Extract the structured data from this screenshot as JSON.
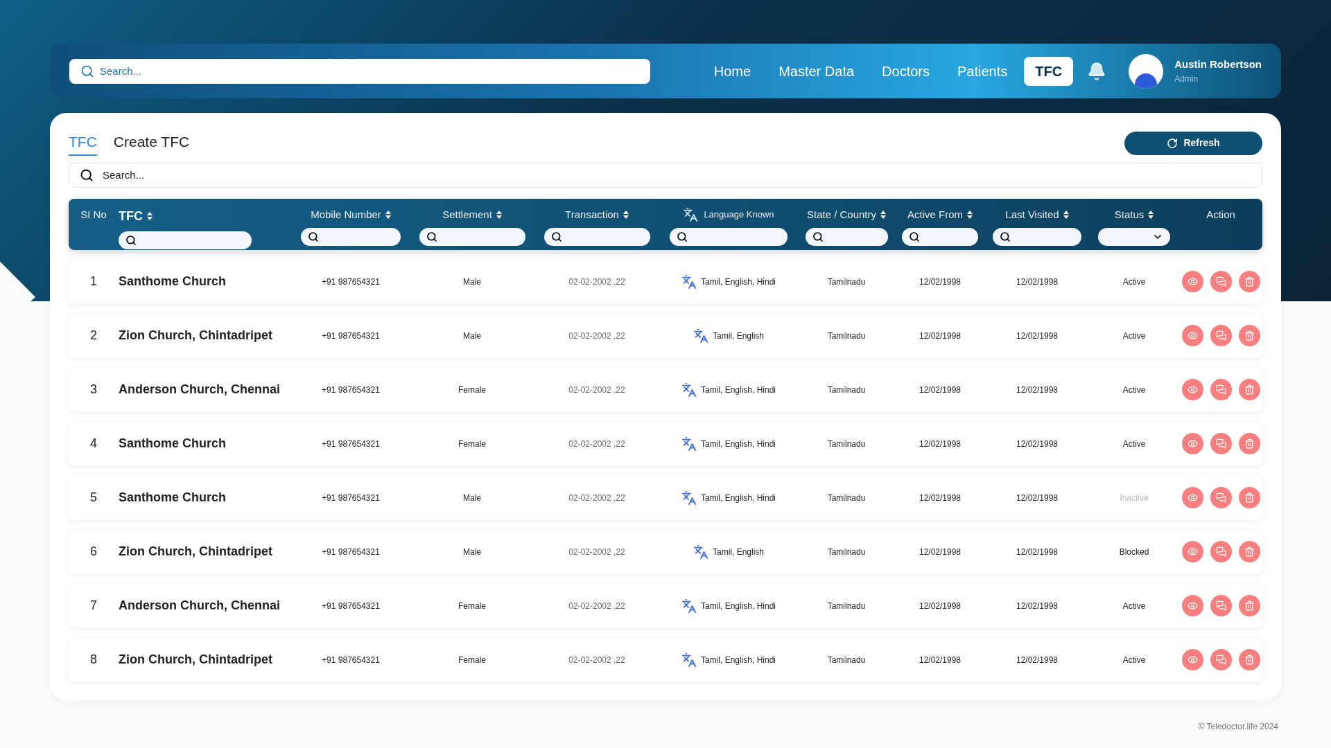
{
  "navbar": {
    "search": {
      "placeholder": "Search..."
    },
    "links": [
      {
        "label": "Home",
        "selected": false
      },
      {
        "label": "Master Data",
        "selected": false
      },
      {
        "label": "Doctors",
        "selected": false
      },
      {
        "label": "Patients",
        "selected": false
      },
      {
        "label": "TFC",
        "selected": true
      }
    ],
    "user": {
      "name": "Austin Robertson",
      "role": "Admin"
    }
  },
  "tabs": [
    {
      "label": "TFC",
      "selected": true
    },
    {
      "label": "Create TFC",
      "selected": false
    }
  ],
  "refresh_button": "Refresh",
  "search": {
    "placeholder": "Search..."
  },
  "table": {
    "columns": [
      {
        "label": "SI No",
        "sortable": false,
        "kind": "plain"
      },
      {
        "label": "TFC",
        "sortable": true,
        "kind": "search"
      },
      {
        "label": "Mobile Number",
        "sortable": true,
        "kind": "search"
      },
      {
        "label": "Settlement",
        "sortable": true,
        "kind": "search"
      },
      {
        "label": "Transaction",
        "sortable": true,
        "kind": "search"
      },
      {
        "label": "Language Known",
        "sortable": false,
        "kind": "search"
      },
      {
        "label": "State / Country",
        "sortable": true,
        "kind": "search"
      },
      {
        "label": "Active From",
        "sortable": true,
        "kind": "search"
      },
      {
        "label": "Last Visited",
        "sortable": true,
        "kind": "search"
      },
      {
        "label": "Status",
        "sortable": true,
        "kind": "select"
      },
      {
        "label": "Action",
        "sortable": false,
        "kind": "plain"
      }
    ],
    "rows": [
      {
        "no": "1",
        "tfc": "Santhome Church",
        "mobile": "+91 987654321",
        "settlement": "Male",
        "transaction": "02-02-2002 ,22",
        "languages": "Tamil, English, Hindi",
        "state": "Tamilnadu",
        "active_from": "12/02/1998",
        "last_visited": "12/02/1998",
        "status": "Active",
        "status_disabled": false
      },
      {
        "no": "2",
        "tfc": "Zion Church, Chintadripet",
        "mobile": "+91 987654321",
        "settlement": "Male",
        "transaction": "02-02-2002 ,22",
        "languages": "Tamil, English",
        "state": "Tamilnadu",
        "active_from": "12/02/1998",
        "last_visited": "12/02/1998",
        "status": "Active",
        "status_disabled": false
      },
      {
        "no": "3",
        "tfc": "Anderson Church, Chennai",
        "mobile": "+91 987654321",
        "settlement": "Female",
        "transaction": "02-02-2002 ,22",
        "languages": "Tamil, English, Hindi",
        "state": "Tamilnadu",
        "active_from": "12/02/1998",
        "last_visited": "12/02/1998",
        "status": "Active",
        "status_disabled": false
      },
      {
        "no": "4",
        "tfc": "Santhome Church",
        "mobile": "+91 987654321",
        "settlement": "Female",
        "transaction": "02-02-2002 ,22",
        "languages": "Tamil, English, Hindi",
        "state": "Tamilnadu",
        "active_from": "12/02/1998",
        "last_visited": "12/02/1998",
        "status": "Active",
        "status_disabled": false
      },
      {
        "no": "5",
        "tfc": "Santhome Church",
        "mobile": "+91 987654321",
        "settlement": "Male",
        "transaction": "02-02-2002 ,22",
        "languages": "Tamil, English, Hindi",
        "state": "Tamilnadu",
        "active_from": "12/02/1998",
        "last_visited": "12/02/1998",
        "status": "Inactive",
        "status_disabled": true
      },
      {
        "no": "6",
        "tfc": "Zion Church, Chintadripet",
        "mobile": "+91 987654321",
        "settlement": "Male",
        "transaction": "02-02-2002 ,22",
        "languages": "Tamil, English",
        "state": "Tamilnadu",
        "active_from": "12/02/1998",
        "last_visited": "12/02/1998",
        "status": "Blocked",
        "status_disabled": false
      },
      {
        "no": "7",
        "tfc": "Anderson Church, Chennai",
        "mobile": "+91 987654321",
        "settlement": "Female",
        "transaction": "02-02-2002 ,22",
        "languages": "Tamil, English, Hindi",
        "state": "Tamilnadu",
        "active_from": "12/02/1998",
        "last_visited": "12/02/1998",
        "status": "Active",
        "status_disabled": false
      },
      {
        "no": "8",
        "tfc": "Zion Church, Chintadripet",
        "mobile": "+91 987654321",
        "settlement": "Female",
        "transaction": "02-02-2002 ,22",
        "languages": "Tamil, English, Hindi",
        "state": "Tamilnadu",
        "active_from": "12/02/1998",
        "last_visited": "12/02/1998",
        "status": "Active",
        "status_disabled": false
      }
    ]
  },
  "footer": "© Teledoctor.life 2024"
}
